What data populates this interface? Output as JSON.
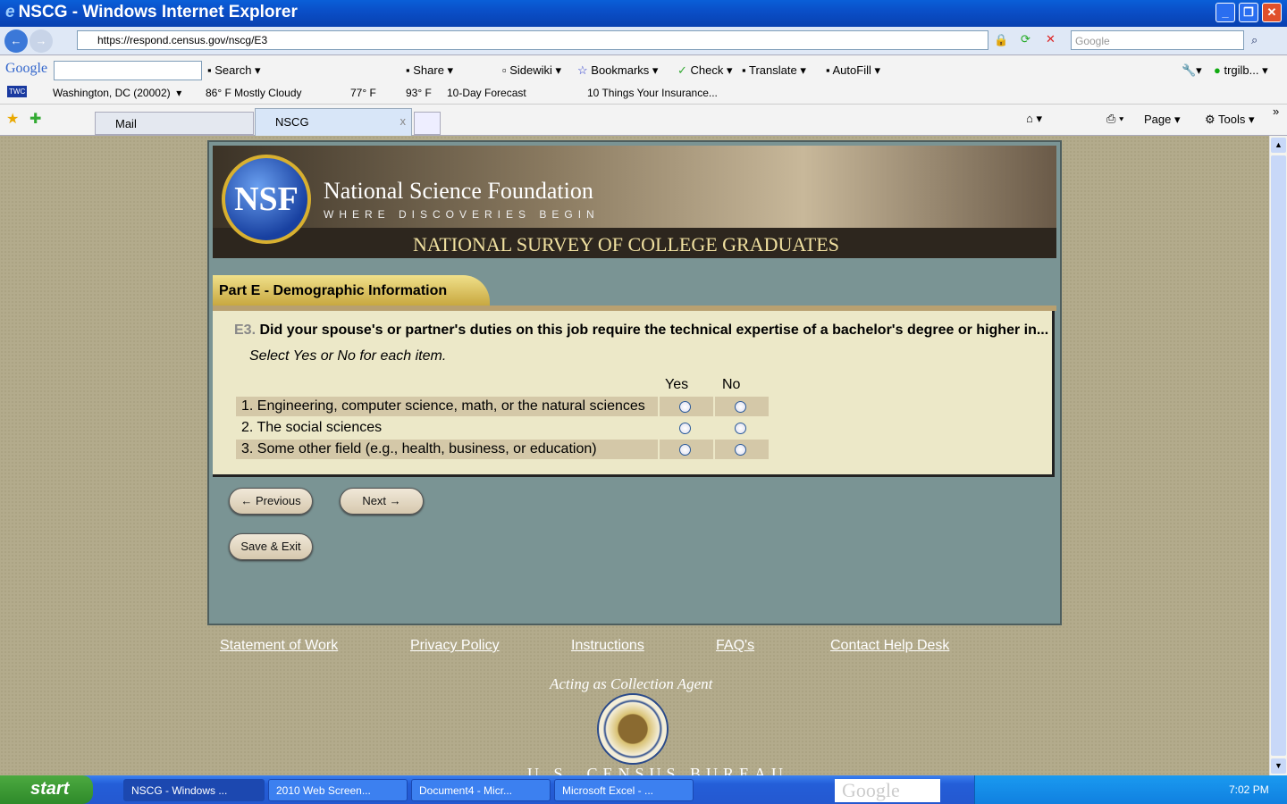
{
  "window": {
    "title": "NSCG - Windows Internet Explorer"
  },
  "address": {
    "url": "https://respond.census.gov/nscg/E3",
    "search_placeholder": "Google"
  },
  "google_toolbar": {
    "logo": "Google",
    "search": "Search",
    "share": "Share",
    "sidewiki": "Sidewiki",
    "bookmarks": "Bookmarks",
    "check": "Check",
    "translate": "Translate",
    "autofill": "AutoFill",
    "user": "trgilb..."
  },
  "twc_bar": {
    "logo": "TWC",
    "location": "Washington, DC (20002)",
    "current": "86° F Mostly Cloudy",
    "low": "77° F",
    "high": "93° F",
    "forecast": "10-Day Forecast",
    "news": "10 Things Your Insurance..."
  },
  "tabs": [
    {
      "label": "Mail"
    },
    {
      "label": "NSCG",
      "close": "x"
    }
  ],
  "command_bar": {
    "page": "Page",
    "tools": "Tools",
    "more": "»"
  },
  "banner": {
    "logo": "NSF",
    "title": "National Science Foundation",
    "tagline": "WHERE DISCOVERIES BEGIN",
    "survey": "NATIONAL SURVEY OF COLLEGE GRADUATES"
  },
  "section": {
    "title": "Part E - Demographic Information"
  },
  "question": {
    "number": "E3.",
    "text": "Did your spouse's or partner's duties on this job require the technical expertise of a bachelor's degree or higher in...",
    "instruction": "Select Yes or No for each item.",
    "col_yes": "Yes",
    "col_no": "No",
    "items": [
      {
        "label": "1. Engineering, computer science, math, or the natural sciences"
      },
      {
        "label": "2. The social sciences"
      },
      {
        "label": "3. Some other field (e.g., health, business, or education)"
      }
    ]
  },
  "buttons": {
    "previous": "Previous",
    "next": "Next",
    "save_exit": "Save & Exit"
  },
  "footer": {
    "links": [
      "Statement of Work",
      "Privacy Policy",
      "Instructions",
      "FAQ's",
      "Contact Help Desk"
    ],
    "agent": "Acting as Collection Agent",
    "census": "U.S. CENSUS BUREAU"
  },
  "taskbar": {
    "start": "start",
    "tasks": [
      "NSCG - Windows ...",
      "2010 Web Screen...",
      "Document4 - Micr...",
      "Microsoft Excel - ..."
    ],
    "google": "Google",
    "clock": "7:02 PM"
  }
}
